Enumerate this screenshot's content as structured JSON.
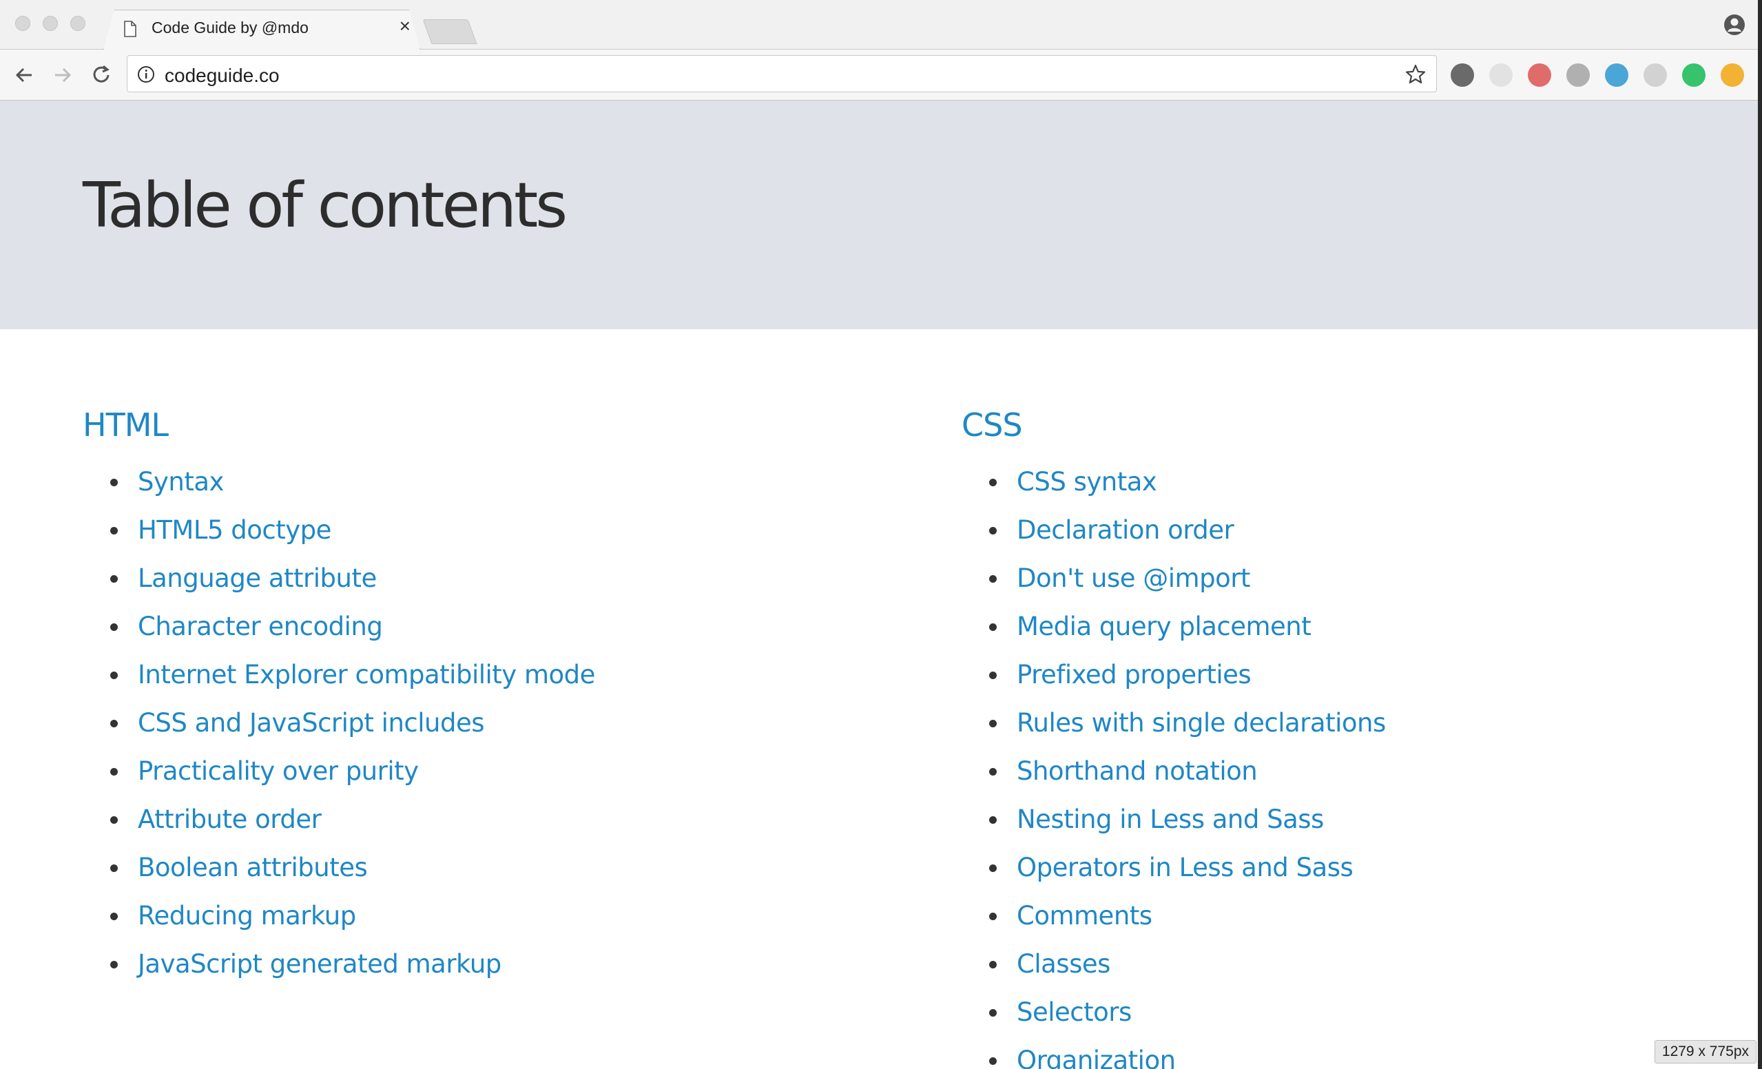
{
  "browser": {
    "tab_title": "Code Guide by @mdo",
    "tab_close": "×",
    "url": "codeguide.co",
    "icons": [
      "back-arrow-icon",
      "forward-arrow-icon",
      "reload-icon",
      "info-icon",
      "star-icon",
      "profile-icon",
      "document-icon"
    ],
    "extensions": [
      {
        "name": "chrome-color-extension-icon",
        "color": "#6a6a6a"
      },
      {
        "name": "grey-circle-extension-icon",
        "color": "#e2e2e2"
      },
      {
        "name": "red-dots-extension-icon",
        "color": "#e06b6b"
      },
      {
        "name": "pin-extension-icon",
        "color": "#b0b0b0"
      },
      {
        "name": "vue-extension-icon",
        "color": "#4aa6d6"
      },
      {
        "name": "grid-extension-icon",
        "color": "#d2d2d2"
      },
      {
        "name": "grammarly-extension-icon",
        "color": "#36c36b"
      },
      {
        "name": "orange-badge-extension-icon",
        "color": "#f2b233"
      }
    ]
  },
  "page": {
    "title": "Table of contents",
    "accent_color": "#1f87c5",
    "header_bg": "#dfe2e9",
    "sections": [
      {
        "heading": "HTML",
        "items": [
          "Syntax",
          "HTML5 doctype",
          "Language attribute",
          "Character encoding",
          "Internet Explorer compatibility mode",
          "CSS and JavaScript includes",
          "Practicality over purity",
          "Attribute order",
          "Boolean attributes",
          "Reducing markup",
          "JavaScript generated markup"
        ]
      },
      {
        "heading": "CSS",
        "items": [
          "CSS syntax",
          "Declaration order",
          "Don't use @import",
          "Media query placement",
          "Prefixed properties",
          "Rules with single declarations",
          "Shorthand notation",
          "Nesting in Less and Sass",
          "Operators in Less and Sass",
          "Comments",
          "Classes",
          "Selectors",
          "Organization"
        ]
      }
    ]
  },
  "overlay": {
    "size_badge": "1279 x 775px"
  }
}
